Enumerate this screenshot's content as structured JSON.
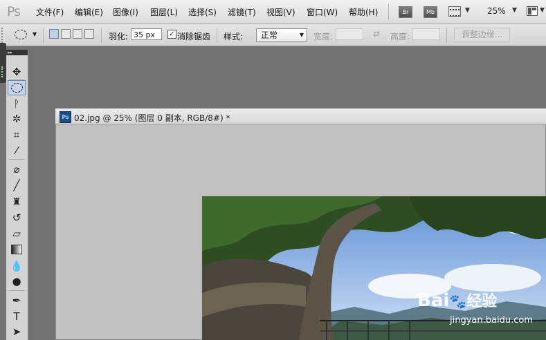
{
  "app": {
    "logo": "Ps"
  },
  "menu": [
    "文件(F)",
    "编辑(E)",
    "图像(I)",
    "图层(L)",
    "选择(S)",
    "滤镜(T)",
    "视图(V)",
    "窗口(W)",
    "帮助(H)"
  ],
  "menubar_buttons": {
    "bridge": "Br",
    "mini_bridge": "Mb"
  },
  "zoom_level": "25%",
  "options": {
    "feather_label": "羽化:",
    "feather_value": "35 px",
    "antialias_label": "消除锯齿",
    "antialias_checked": "✓",
    "style_label": "样式:",
    "style_value": "正常",
    "width_label": "宽度:",
    "height_label": "高度:",
    "refine_edge": "调整边缘..."
  },
  "document": {
    "badge": "Ps",
    "title": "02.jpg @ 25% (图层 0 副本, RGB/8#) *"
  },
  "watermark": {
    "brand": "Bai",
    "brand2": "经验",
    "url": "jingyan.baidu.com"
  },
  "colors": {
    "accent": "#5c7ea8",
    "app_bg": "#727272",
    "canvas_bg": "#c0c0c0"
  }
}
